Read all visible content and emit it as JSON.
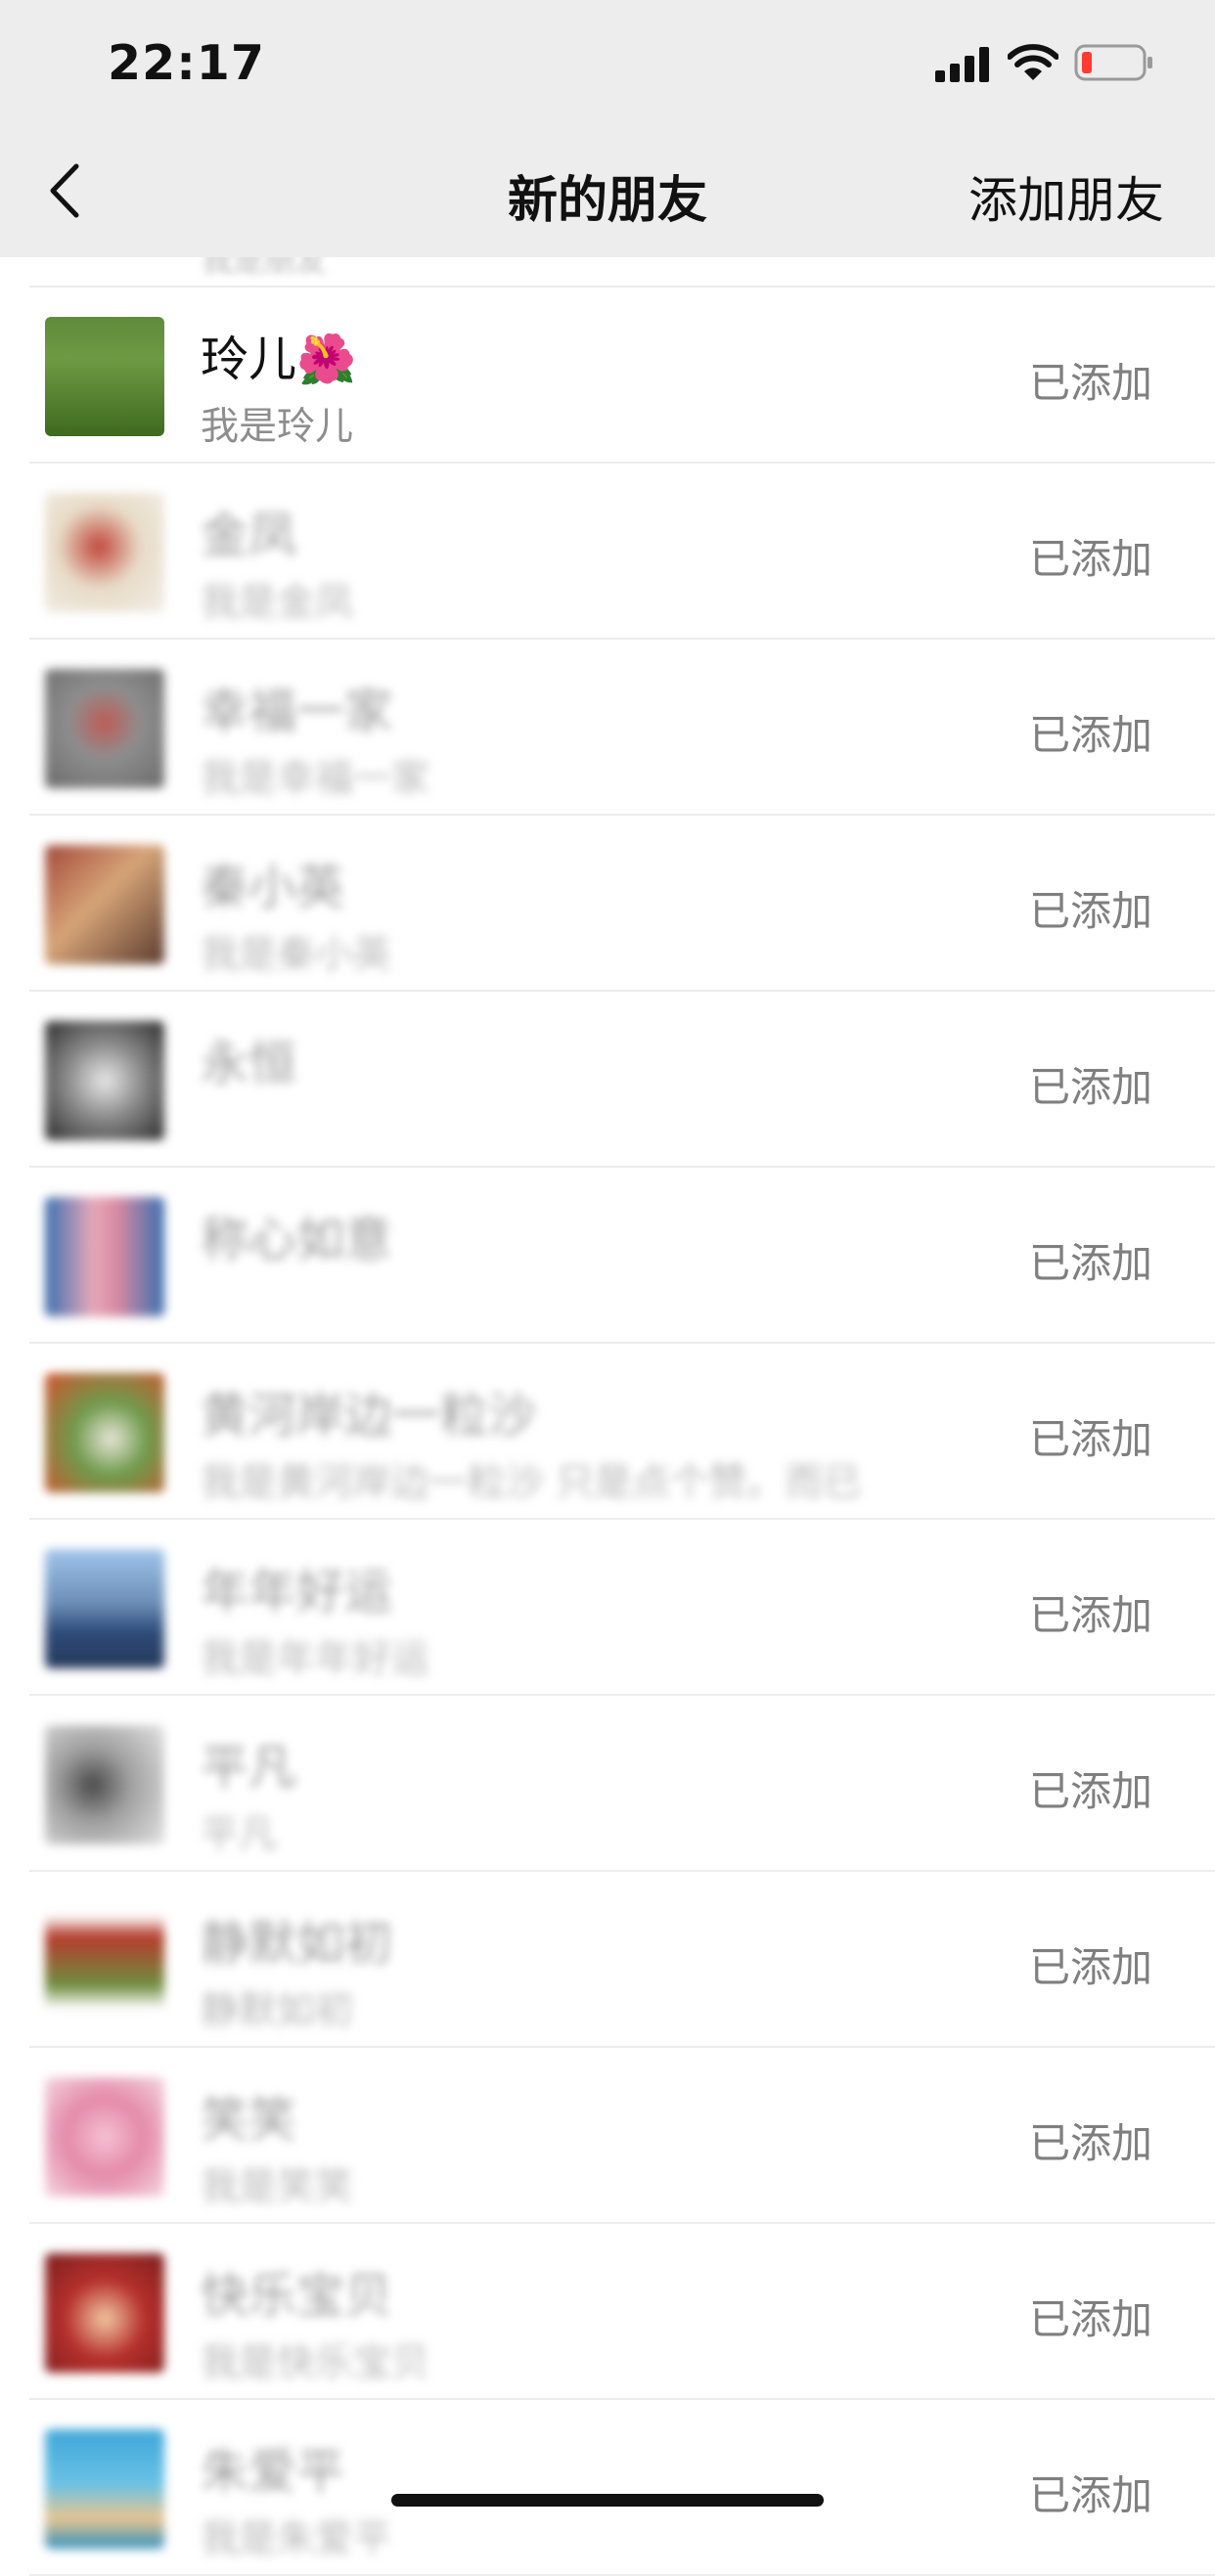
{
  "status_bar": {
    "time": "22:17"
  },
  "nav": {
    "title": "新的朋友",
    "add_friend": "添加朋友"
  },
  "partial_top_text": "我是朋友",
  "friends": [
    {
      "name": "玲儿🌺",
      "sub": "我是玲儿",
      "status": "已添加"
    },
    {
      "name": "金凤",
      "sub": "我是金凤",
      "status": "已添加"
    },
    {
      "name": "幸福一家",
      "sub": "我是幸福一家",
      "status": "已添加"
    },
    {
      "name": "秦小英",
      "sub": "我是秦小英",
      "status": "已添加"
    },
    {
      "name": "永恒",
      "sub": "",
      "status": "已添加"
    },
    {
      "name": "称心如意",
      "sub": "",
      "status": "已添加"
    },
    {
      "name": "黄河岸边一粒沙",
      "sub": "我是黄河岸边一粒沙 只是点个赞。而已",
      "status": "已添加"
    },
    {
      "name": "年年好运",
      "sub": "我是年年好运",
      "status": "已添加"
    },
    {
      "name": "平凡",
      "sub": "平凡",
      "status": "已添加"
    },
    {
      "name": "静默如初",
      "sub": "静默如初",
      "status": "已添加"
    },
    {
      "name": "笑笑",
      "sub": "我是笑笑",
      "status": "已添加"
    },
    {
      "name": "快乐宝贝",
      "sub": "我是快乐宝贝",
      "status": "已添加"
    },
    {
      "name": "朱爱平",
      "sub": "我是朱爱平",
      "status": "已添加"
    }
  ],
  "colors": {
    "nav_bg": "#ededed",
    "status_text": "#7f7f7f",
    "battery_low": "#ff3b30"
  }
}
